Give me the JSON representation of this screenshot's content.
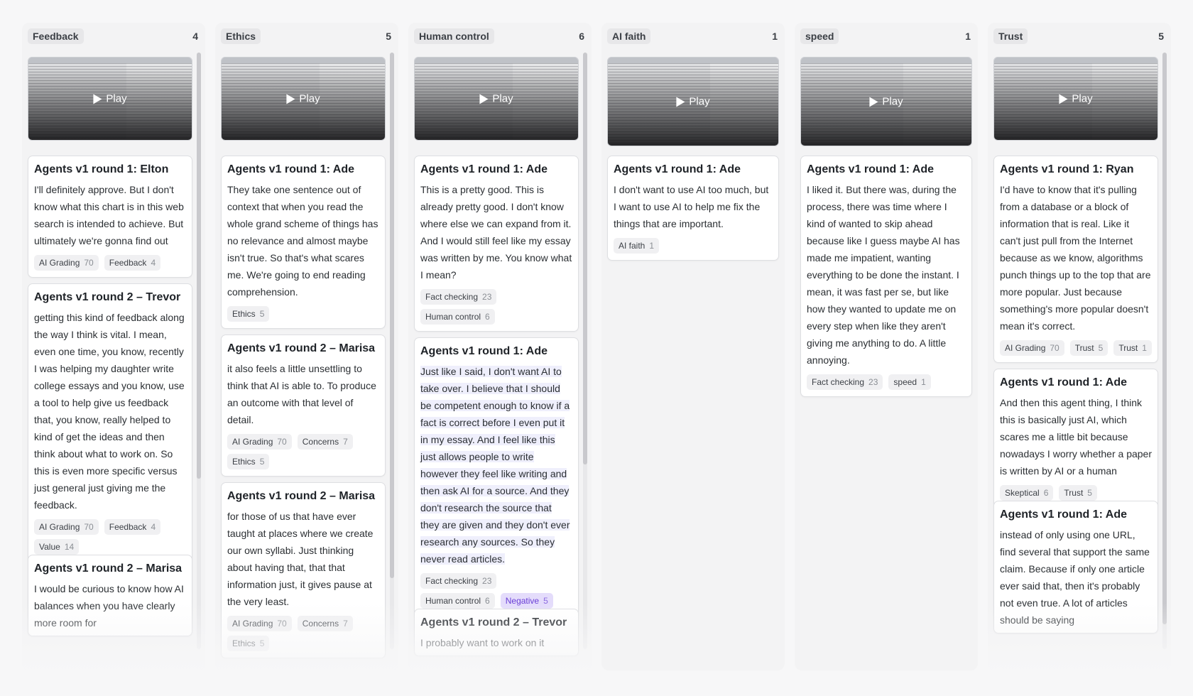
{
  "play_label": "Play",
  "columns": [
    {
      "title": "Feedback",
      "count": "4",
      "cards": [
        {
          "title": "Agents v1 round 1: Elton",
          "text": "I'll definitely approve. But I don't know what this chart is in this web search is intended to achieve. But ultimately we're gonna find out",
          "tags": [
            {
              "label": "AI Grading",
              "count": "70"
            },
            {
              "label": "Feedback",
              "count": "4"
            }
          ]
        },
        {
          "title": "Agents v1 round 2 – Trevor",
          "text": "getting this kind of feedback along the way I think is vital. I mean, even one time, you know, recently I was helping my daughter write college essays and you know, use a tool to help give us feedback that, you know, really helped to kind of get the ideas and then think about what to work on. So this is even more specific versus just general just giving me the feedback.",
          "tags": [
            {
              "label": "AI Grading",
              "count": "70"
            },
            {
              "label": "Feedback",
              "count": "4"
            },
            {
              "label": "Value",
              "count": "14"
            }
          ]
        },
        {
          "title": "Agents v1 round 2 – Marisa",
          "text": "I would be curious to know how AI balances when you have clearly more room for",
          "tags": []
        }
      ]
    },
    {
      "title": "Ethics",
      "count": "5",
      "cards": [
        {
          "title": "Agents v1 round 1: Ade",
          "text": "They take one sentence out of context that when you read the whole grand scheme of things has no relevance and almost maybe isn't true. So that's what scares me. We're going to end reading comprehension.",
          "tags": [
            {
              "label": "Ethics",
              "count": "5"
            }
          ]
        },
        {
          "title": "Agents v1 round 2 – Marisa",
          "text": "it also feels a little unsettling to think that AI is able to. To produce an outcome with that level of detail.",
          "tags": [
            {
              "label": "AI Grading",
              "count": "70"
            },
            {
              "label": "Concerns",
              "count": "7"
            },
            {
              "label": "Ethics",
              "count": "5"
            }
          ]
        },
        {
          "title": "Agents v1 round 2 – Marisa",
          "text": "for those of us that have ever taught at places where we create our own syllabi. Just thinking about having that, that that information just, it gives pause at the very least.",
          "tags": [
            {
              "label": "AI Grading",
              "count": "70"
            },
            {
              "label": "Concerns",
              "count": "7"
            },
            {
              "label": "Ethics",
              "count": "5"
            }
          ]
        }
      ]
    },
    {
      "title": "Human control",
      "count": "6",
      "cards": [
        {
          "title": "Agents v1 round 1: Ade",
          "text": "This is a pretty good. This is already pretty good. I don't know where else we can expand from it. And I would still feel like my essay was written by me. You know what I mean?",
          "tags": [
            {
              "label": "Fact checking",
              "count": "23"
            },
            {
              "label": "Human control",
              "count": "6"
            }
          ]
        },
        {
          "title": "Agents v1 round 1: Ade",
          "text": "Just like I said, I don't want AI to take over. I believe that I should be competent enough to know if a fact is correct before I even put it in my essay. And I feel like this just allows people to write however they feel like writing and then ask AI for a source. And they don't research the source that they are given and they don't ever research any sources. So they never read articles.",
          "tags": [
            {
              "label": "Fact checking",
              "count": "23"
            },
            {
              "label": "Human control",
              "count": "6"
            },
            {
              "label": "Negative",
              "count": "5",
              "purple": true
            }
          ]
        },
        {
          "title": "Agents v1 round 2 – Trevor",
          "text": "I probably want to work on it",
          "tags": []
        }
      ]
    },
    {
      "title": "AI faith",
      "count": "1",
      "cards": [
        {
          "title": "Agents v1 round 1: Ade",
          "text": "I don't want to use AI too much, but I want to use AI to help me fix the things that are important.",
          "tags": [
            {
              "label": "AI faith",
              "count": "1"
            }
          ]
        }
      ]
    },
    {
      "title": "speed",
      "count": "1",
      "cards": [
        {
          "title": "Agents v1 round 1: Ade",
          "text": "I liked it. But there was, during the process, there was time where I kind of wanted to skip ahead because like I guess maybe AI has made me impatient, wanting everything to be done the instant. I mean, it was fast per se, but like how they wanted to update me on every step when like they aren't giving me anything to do. A little annoying.",
          "tags": [
            {
              "label": "Fact checking",
              "count": "23"
            },
            {
              "label": "speed",
              "count": "1"
            }
          ]
        }
      ]
    },
    {
      "title": "Trust",
      "count": "5",
      "cards": [
        {
          "title": "Agents v1 round 1: Ryan",
          "text": "I'd have to know that it's pulling from a database or a block of information that is real. Like it can't just pull from the Internet because as we know, algorithms punch things up to the top that are more popular. Just because something's more popular doesn't mean it's correct.",
          "tags": [
            {
              "label": "AI Grading",
              "count": "70"
            },
            {
              "label": "Trust",
              "count": "5"
            },
            {
              "label": "Trust",
              "count": "1"
            }
          ]
        },
        {
          "title": "Agents v1 round 1: Ade",
          "text": "And then this agent thing, I think this is basically just AI, which scares me a little bit because nowadays I worry whether a paper is written by AI or a human",
          "tags": [
            {
              "label": "Skeptical",
              "count": "6"
            },
            {
              "label": "Trust",
              "count": "5"
            }
          ]
        },
        {
          "title": "Agents v1 round 1: Ade",
          "text": "instead of only using one URL, find several that support the same claim. Because if only one article ever said that, then it's probably not even true. A lot of articles should be saying",
          "tags": []
        }
      ]
    }
  ]
}
